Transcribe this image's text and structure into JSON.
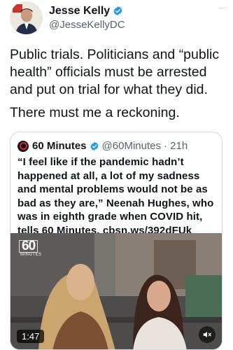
{
  "tweet": {
    "author": {
      "display_name": "Jesse Kelly",
      "handle": "@JesseKellyDC",
      "verified": true
    },
    "paragraphs": [
      "Public trials. Politicians and “public health” officials must be arrested and put on trial for what they did.",
      "There must me a reckoning."
    ],
    "more_icon": "more-dots-icon"
  },
  "quoted_tweet": {
    "author": {
      "display_name": "60 Minutes",
      "handle": "@60Minutes",
      "verified": true
    },
    "time": "· 21h",
    "text": "“I feel like if the pandemic hadn’t happened at all, a lot of my sadness and mental problems would not be as bad as they are,” Neenah Hughes, who was in eighth grade when COVID hit, tells 60 Minutes. cbsn.ws/392dFUk",
    "video": {
      "logo_text": "60",
      "logo_sub": "MINUTES",
      "duration": "1:47",
      "mute_icon": "mute-icon"
    }
  },
  "colors": {
    "verified_blue": "#1d9bf0",
    "text": "#0f1419",
    "secondary": "#536471",
    "border": "#cfd9de"
  }
}
